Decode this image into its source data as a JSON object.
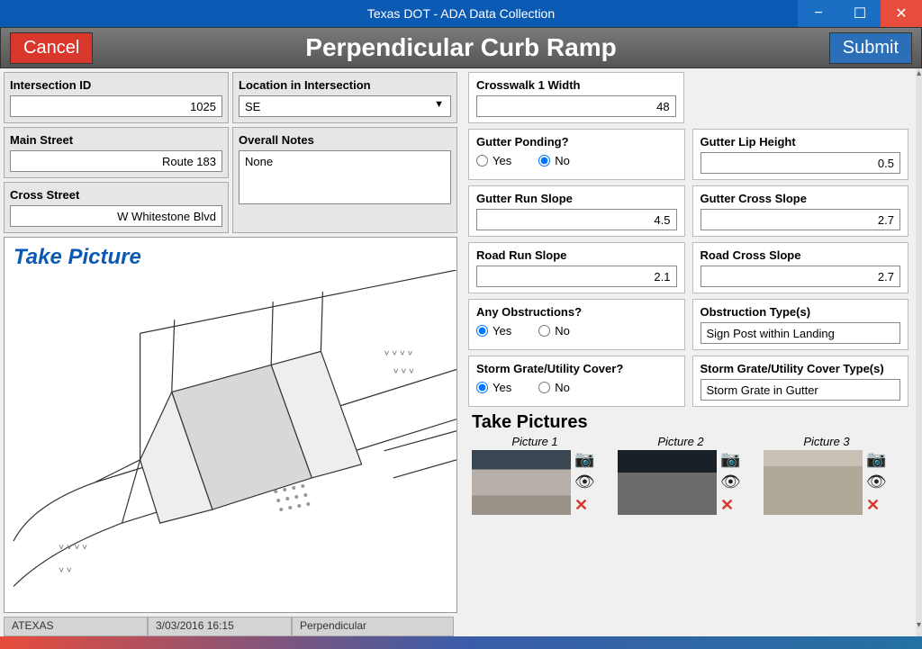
{
  "window": {
    "title": "Texas DOT - ADA Data Collection"
  },
  "header": {
    "title": "Perpendicular Curb Ramp",
    "cancel": "Cancel",
    "submit": "Submit"
  },
  "left": {
    "intersection_id_label": "Intersection ID",
    "intersection_id_value": "1025",
    "main_street_label": "Main Street",
    "main_street_value": "Route 183",
    "cross_street_label": "Cross Street",
    "cross_street_value": "W Whitestone Blvd",
    "location_label": "Location in Intersection",
    "location_value": "SE",
    "overall_notes_label": "Overall Notes",
    "overall_notes_value": "None",
    "take_picture": "Take Picture"
  },
  "statusbar": {
    "user": "ATEXAS",
    "datetime": "3/03/2016 16:15",
    "type": "Perpendicular"
  },
  "right": {
    "crosswalk1_width_label": "Crosswalk 1 Width",
    "crosswalk1_width_value": "48",
    "gutter_ponding_label": "Gutter Ponding?",
    "yes": "Yes",
    "no": "No",
    "gutter_ponding_value": "No",
    "gutter_lip_height_label": "Gutter Lip Height",
    "gutter_lip_height_value": "0.5",
    "gutter_run_slope_label": "Gutter Run Slope",
    "gutter_run_slope_value": "4.5",
    "gutter_cross_slope_label": "Gutter Cross Slope",
    "gutter_cross_slope_value": "2.7",
    "road_run_slope_label": "Road Run Slope",
    "road_run_slope_value": "2.1",
    "road_cross_slope_label": "Road Cross Slope",
    "road_cross_slope_value": "2.7",
    "any_obstructions_label": "Any Obstructions?",
    "any_obstructions_value": "Yes",
    "obstruction_types_label": "Obstruction Type(s)",
    "obstruction_types_value": "Sign Post within Landing",
    "storm_grate_label": "Storm Grate/Utility Cover?",
    "storm_grate_value": "Yes",
    "storm_grate_types_label": "Storm Grate/Utility Cover Type(s)",
    "storm_grate_types_value": "Storm Grate in Gutter",
    "take_pictures_title": "Take Pictures",
    "pic1": "Picture 1",
    "pic2": "Picture 2",
    "pic3": "Picture 3"
  }
}
